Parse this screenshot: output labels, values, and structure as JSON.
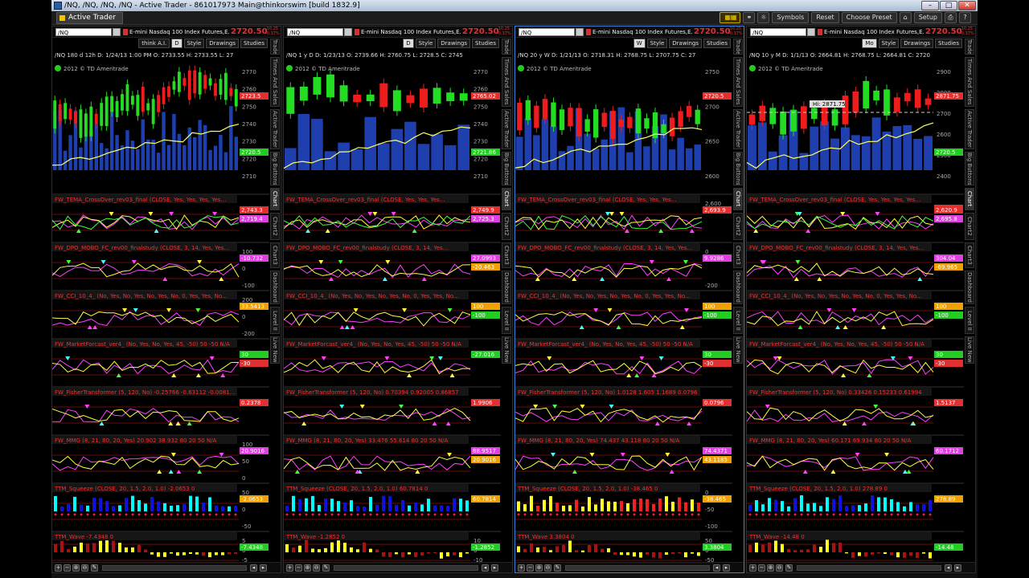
{
  "window": {
    "title": "/NQ, /NQ, /NQ, /NQ - Active Trader - 861017973 Main@thinkorswim [build 1832.9]",
    "min": "–",
    "max": "□",
    "close": "✕"
  },
  "menubar": {
    "app_tab": "Active Trader",
    "buttons": {
      "symbols": "Symbols",
      "reset": "Reset",
      "choose_preset": "Choose Preset",
      "setup": "Setup"
    }
  },
  "colors": {
    "up": "#22dd22",
    "down": "#ee1c1c",
    "volume": "#1f3fae",
    "price": "#e03030",
    "accent": "#3e7fd6"
  },
  "side_tabs": [
    "Trade",
    "Times And Sales",
    "Active Trader",
    "Big Buttons",
    "Chart",
    "Chart2",
    "Chart3",
    "Dashboard",
    "Level II",
    "Live News"
  ],
  "common": {
    "symbol": "/NQ",
    "desc": "E-mini Nasdaq 100 Index Futures,E...",
    "price": "2720.50",
    "change": "-10.25 -0.37%",
    "watermark": "2012 © TD Ameritrade",
    "style": "Style",
    "drawings": "Drawings",
    "studies": "Studies"
  },
  "panels": [
    {
      "agg": "think A.I.",
      "period_btn": "D",
      "ohlc": "/NQ 180 d 12h   D: 1/24/13 1:00 PM   O: 2733.55  H: 2733.55  L: 27",
      "price_axis": [
        "2770",
        "2760",
        "2750",
        "2740",
        "2730",
        "2720",
        "2710"
      ],
      "price_tags": [
        "2723.5",
        "2720.5"
      ],
      "studies": [
        {
          "title": "FW_TEMA_CrossOver_rev03_final (CLOSE, Yes, Yes, Yes, Yes...",
          "tags": [
            "2,743.3",
            "2,719.4"
          ],
          "axis": []
        },
        {
          "title": "FW_DPO_MOBO_FC_rev00_finalstudy (CLOSE, 3, 14, Yes, Yes...",
          "tags": [
            "-10.732"
          ],
          "axis": [
            "100",
            "0",
            "-100"
          ]
        },
        {
          "title": "FW_CCI_10_4_ (No, Yes, No, Yes, No, Yes, No, 0, Yes, Yes, No...",
          "tags": [
            "33.5413"
          ],
          "axis": [
            "200",
            "0",
            "-200"
          ]
        },
        {
          "title": "FW_MarketForcast_ver4_ (No, Yes, No, Yes, 45, -50)   50  -50  N/A",
          "tags": [
            "30",
            "-30"
          ],
          "axis": []
        },
        {
          "title": "FW_FisherTransformer (5, 120, No)   -0.25766   -0.63112   -0.0081...",
          "tags": [
            "0.2378"
          ],
          "axis": []
        },
        {
          "title": "FW_MMG (8, 21, 80, 20, Yes)   20.902   38.932   80  20  50  N/A",
          "tags": [
            "20.9016"
          ],
          "axis": [
            "100",
            "50",
            "0"
          ]
        },
        {
          "title": "TTM_Squeeze (CLOSE, 20, 1.5, 2.0, 1.0)   -2.0653   0",
          "tags": [
            "-2.0653"
          ],
          "axis": [
            "50",
            "0",
            "-50"
          ]
        },
        {
          "title": "TTM_Wave   -7.4348   0",
          "tags": [
            "-7.4348"
          ],
          "axis": [
            "5",
            "0",
            "-5"
          ]
        }
      ],
      "dates": [
        "1/14",
        "1/21",
        "1/28"
      ]
    },
    {
      "agg": "",
      "period_btn": "D",
      "ohlc": "/NQ 1 y D   D: 1/23/13   O: 2739.66  H: 2760.75  L: 2728.5  C: 2745",
      "price_axis": [
        "2770",
        "2760",
        "2750",
        "2740",
        "2730",
        "2720",
        "2710"
      ],
      "price_tags": [
        "2765.02",
        "2721.86"
      ],
      "studies": [
        {
          "title": "FW_TEMA_CrossOver_rev03_final (CLOSE, Yes, Yes, Yes...",
          "tags": [
            "2,749.9",
            "2,725.3"
          ],
          "axis": []
        },
        {
          "title": "FW_DPO_MOBO_FC_rev00_finalstudy (CLOSE, 3, 14, Yes...",
          "tags": [
            "27.0993",
            "-20.463"
          ],
          "axis": []
        },
        {
          "title": "FW_CCI_10_4_ (No, Yes, No, Yes, No, Yes, No, 0, Yes, Yes, No...",
          "tags": [
            "100",
            "-100"
          ],
          "axis": []
        },
        {
          "title": "FW_MarketForcast_ver4_ (No, Yes, No, Yes, 45, -50)   50  -50  N/A",
          "tags": [
            "-27.016"
          ],
          "axis": []
        },
        {
          "title": "FW_FisherTransformer (5, 120, No)   0.70394   0.92005   0.86857",
          "tags": [
            "1.9906"
          ],
          "axis": []
        },
        {
          "title": "FW_MMG (8, 21, 80, 20, Yes)   33.476   55.614   80  20  50  N/A",
          "tags": [
            "88.9517",
            "20.9016"
          ],
          "axis": []
        },
        {
          "title": "TTM_Squeeze (CLOSE, 20, 1.5, 2.0, 1.0)   60.7814   0",
          "tags": [
            "60.7814"
          ],
          "axis": []
        },
        {
          "title": "TTM_Wave   -1.2852   0",
          "tags": [
            "-1.2852"
          ],
          "axis": [
            "10",
            "0",
            "-10"
          ]
        }
      ],
      "dates": [
        "1/21",
        "1/23",
        "1/28",
        "2/4"
      ]
    },
    {
      "agg": "",
      "period_btn": "W",
      "ohlc": "/NQ 20 y W   D: 1/21/13   O: 2718.31  H: 2768.75  L: 2707.75  C: 27",
      "price_axis": [
        "2750",
        "2700",
        "2650",
        "2600"
      ],
      "price_tags": [
        "2720.5"
      ],
      "studies": [
        {
          "title": "FW_TEMA_CrossOver_rev03_final (CLOSE, Yes, Yes, Yes...",
          "tags": [
            "2,693.9"
          ],
          "axis": [
            "2,600"
          ]
        },
        {
          "title": "FW_DPO_MOBO_FC_rev00_finalstudy (CLOSE, 3, 14, Yes, Yes...",
          "tags": [
            "9.9286"
          ],
          "axis": [
            "0",
            "-200"
          ]
        },
        {
          "title": "FW_CCI_10_4_ (No, Yes, No, Yes, No, Yes, No, 0, Yes, Yes, No...",
          "tags": [
            "100",
            "-100"
          ],
          "axis": []
        },
        {
          "title": "FW_MarketForcast_ver4_ (No, Yes, No, Yes, 45, -50)   50  -50  N/A",
          "tags": [
            "30",
            "-30"
          ],
          "axis": []
        },
        {
          "title": "FW_FisherTransformer (5, 120, No)   1.0128   1.605   1.1689   0.0796",
          "tags": [
            "0.0796"
          ],
          "axis": []
        },
        {
          "title": "FW_MMG (8, 21, 80, 20, Yes)   74.437   43.118   80  20  50  N/A",
          "tags": [
            "74.4371",
            "43.1185"
          ],
          "axis": []
        },
        {
          "title": "TTM_Squeeze (CLOSE, 20, 1.5, 2.0, 1.0)   -38.465   0",
          "tags": [
            "-38.465"
          ],
          "axis": [
            "0",
            "-50",
            "-100"
          ]
        },
        {
          "title": "TTM_Wave   3.3804   0",
          "tags": [
            "3.3804"
          ],
          "axis": [
            "50",
            "0",
            "-50"
          ]
        }
      ],
      "dates": [
        "Dec",
        "13",
        "Feb",
        "Mar"
      ]
    },
    {
      "agg": "",
      "period_btn": "Mo",
      "ohlc": "/NQ 10 y M   D: 1/1/13   O: 2664.81  H: 2768.75  L: 2664.81  C: 2720",
      "price_axis": [
        "2900",
        "2800",
        "2700",
        "2600",
        "2500",
        "2400"
      ],
      "price_tags": [
        "2871.75",
        "2720.5",
        "2715.44"
      ],
      "studies": [
        {
          "title": "FW_TEMA_CrossOver_rev03_final (CLOSE, Yes, Yes, Yes, Yes...",
          "tags": [
            "2,620.9",
            "2,695.8"
          ],
          "axis": []
        },
        {
          "title": "FW_DPO_MOBO_FC_rev00_finalstudy (CLOSE, 3, 14, Yes, Yes...",
          "tags": [
            "304.04",
            "-69.965"
          ],
          "axis": []
        },
        {
          "title": "FW_CCI_10_4_ (No, Yes, No, Yes, No, Yes, No, 0, Yes, Yes, No...",
          "tags": [
            "100",
            "-100"
          ],
          "axis": []
        },
        {
          "title": "FW_MarketForcast_ver4_ (No, Yes, No, Yes, 45, -50)   50  -50  N/A",
          "tags": [
            "30",
            "-30"
          ],
          "axis": []
        },
        {
          "title": "FW_FisherTransformer (5, 120, No)   0.33426   0.15233   0.61994",
          "tags": [
            "1.5137"
          ],
          "axis": []
        },
        {
          "title": "FW_MMG (8, 21, 80, 20, Yes)   60.171   69.934   80  20  50  N/A",
          "tags": [
            "60.1712"
          ],
          "axis": []
        },
        {
          "title": "TTM_Squeeze (CLOSE, 20, 1.5, 2.0, 1.0)   278.89   0",
          "tags": [
            "278.89"
          ],
          "axis": []
        },
        {
          "title": "TTM_Wave   -14.48   0",
          "tags": [
            "-14.48"
          ],
          "axis": []
        }
      ],
      "dates": [
        "Jul",
        "Oct",
        "13",
        "Apr"
      ],
      "hi_label": "Hi: 2871.75"
    }
  ]
}
